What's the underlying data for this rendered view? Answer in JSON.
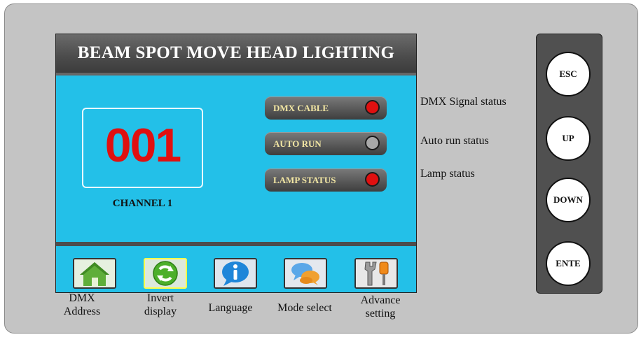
{
  "screen": {
    "title": "BEAM SPOT MOVE HEAD LIGHTING",
    "readout_value": "001",
    "channel_label": "CHANNEL 1"
  },
  "status_indicators": [
    {
      "label": "DMX CABLE",
      "state": "active",
      "color": "#e01010",
      "description": "DMX Signal status"
    },
    {
      "label": "AUTO RUN",
      "state": "inactive",
      "color": "#a8a8a8",
      "description": "Auto run status"
    },
    {
      "label": "LAMP STATUS",
      "state": "active",
      "color": "#e01010",
      "description": "Lamp status"
    }
  ],
  "menu_icons": [
    {
      "icon": "home-icon",
      "caption_line1": "DMX",
      "caption_line2": "Address",
      "selected": false
    },
    {
      "icon": "refresh-icon",
      "caption_line1": "Invert",
      "caption_line2": "display",
      "selected": true
    },
    {
      "icon": "info-icon",
      "caption_line1": "Language",
      "caption_line2": "",
      "selected": false
    },
    {
      "icon": "chat-bubbles-icon",
      "caption_line1": "Mode select",
      "caption_line2": "",
      "selected": false
    },
    {
      "icon": "tools-icon",
      "caption_line1": "Advance",
      "caption_line2": "setting",
      "selected": false
    }
  ],
  "keypad": {
    "esc": "ESC",
    "up": "UP",
    "down": "DOWN",
    "enter": "ENTE"
  },
  "colors": {
    "screen_bg": "#23c0e8",
    "readout": "#e01010",
    "title_bar": "#4d4d4d",
    "status_text": "#f2e6a3"
  }
}
